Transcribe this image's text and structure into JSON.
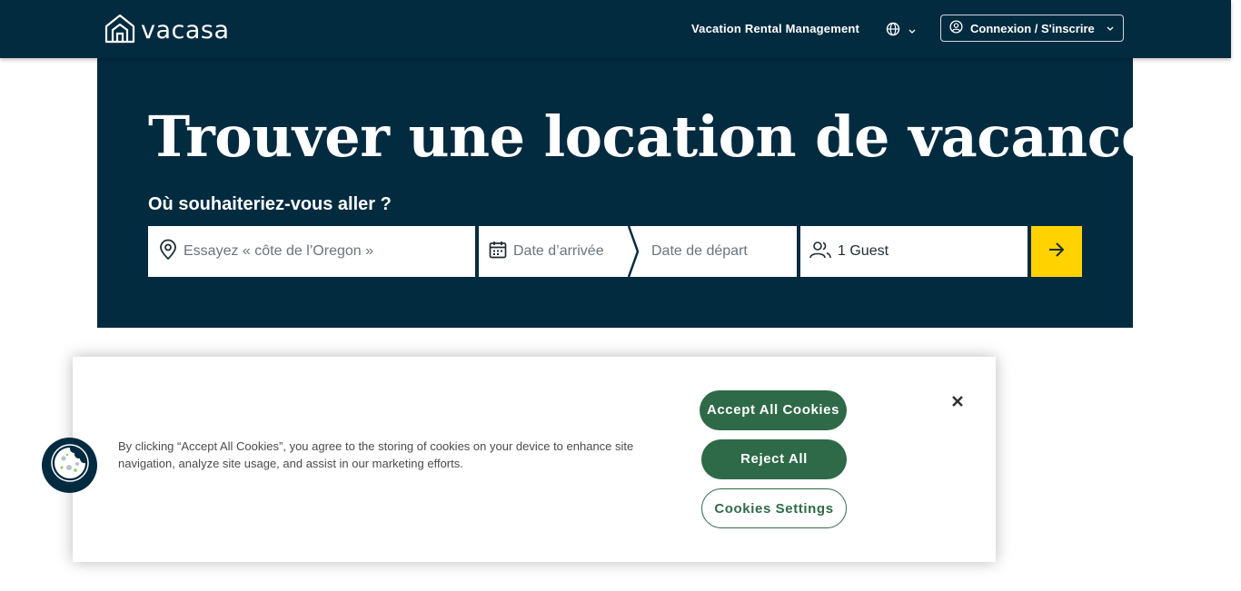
{
  "header": {
    "brand": "vacasa",
    "nav_link": "Vacation Rental Management",
    "login_label": "Connexion / S'inscrire"
  },
  "hero": {
    "title": "Trouver une location de vacances",
    "subtitle": "Où souhaiteriez-vous aller ?",
    "search": {
      "destination_placeholder": "Essayez « côte de l’Oregon »",
      "arrival_placeholder": "Date d’arrivée",
      "departure_placeholder": "Date de départ",
      "guests_value": "1 Guest"
    }
  },
  "cookie_banner": {
    "text": "By clicking “Accept All Cookies”, you agree to the storing of cookies on your device to enhance site navigation, analyze site usage, and assist in our marketing efforts.",
    "accept_label": "Accept All Cookies",
    "reject_label": "Reject All",
    "settings_label": "Cookies Settings"
  },
  "icons": [
    "home-logo-icon",
    "globe-icon",
    "chevron-down-icon",
    "user-circle-icon",
    "location-pin-icon",
    "calendar-icon",
    "guests-icon",
    "arrow-right-icon",
    "close-icon",
    "cookie-icon"
  ],
  "colors": {
    "navy": "#022b40",
    "accent_yellow": "#ffd200",
    "cookie_green": "#2f6a48"
  }
}
